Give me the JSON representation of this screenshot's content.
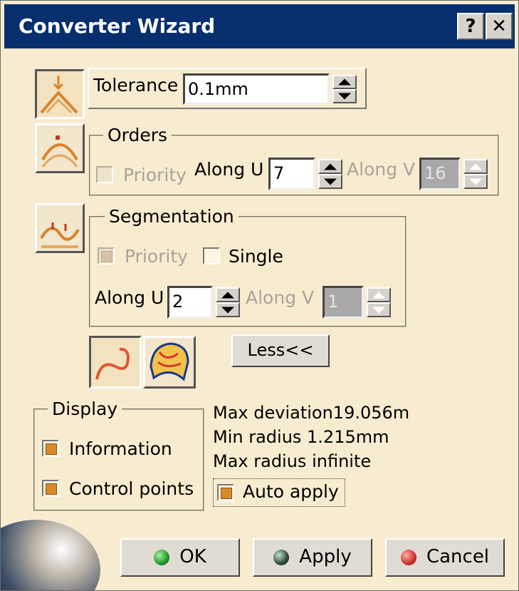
{
  "window": {
    "title": "Converter Wizard",
    "help_label": "?",
    "close_label": "✕"
  },
  "tolerance": {
    "label": "Tolerance",
    "value": "0.1mm"
  },
  "orders": {
    "legend": "Orders",
    "priority_label": "Priority",
    "along_u_label": "Along U",
    "along_u_value": "7",
    "along_v_label": "Along V",
    "along_v_value": "16"
  },
  "segmentation": {
    "legend": "Segmentation",
    "priority_label": "Priority",
    "single_label": "Single",
    "along_u_label": "Along U",
    "along_u_value": "2",
    "along_v_label": "Along V",
    "along_v_value": "1"
  },
  "less_button": "Less<<",
  "display": {
    "legend": "Display",
    "information_label": "Information",
    "control_points_label": "Control points"
  },
  "info": {
    "max_deviation": "Max deviation19.056m",
    "min_radius": "Min radius 1.215mm",
    "max_radius": "Max radius infinite"
  },
  "auto_apply_label": "Auto apply",
  "buttons": {
    "ok": "OK",
    "apply": "Apply",
    "cancel": "Cancel"
  },
  "colors": {
    "titlebar": "#072f6e",
    "dialog_bg": "#f8ecd0",
    "check_on": "#d98a2a",
    "ok_dot": "#1f9a2a",
    "apply_dot": "#2b4a3a",
    "cancel_dot": "#d0302a"
  }
}
